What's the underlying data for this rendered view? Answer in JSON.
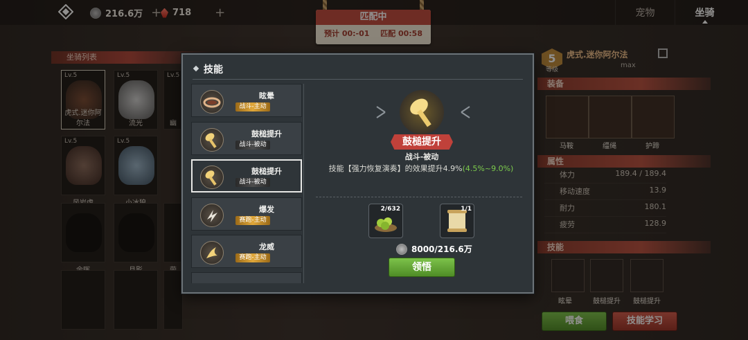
{
  "topbar": {
    "silver": "216.6万",
    "gems": "718",
    "plus": "+"
  },
  "tabs": [
    {
      "label": "宠物"
    },
    {
      "label": "坐骑"
    }
  ],
  "match": {
    "title": "匹配中",
    "estimate": "预计 00:-01",
    "elapsed": "匹配 00:58"
  },
  "mount_list": {
    "header": "坐骑列表",
    "cards": [
      {
        "level": "Lv.5",
        "name": "虎式.迷你阿尔法"
      },
      {
        "level": "Lv.5",
        "name": "流光"
      },
      {
        "level": "Lv.5",
        "name": "幽"
      },
      {
        "level": "Lv.5",
        "name": "风岩虎"
      },
      {
        "level": "Lv.5",
        "name": "小冰狼"
      },
      {
        "level": "",
        "name": "余晖"
      },
      {
        "level": "",
        "name": "月影"
      },
      {
        "level": "",
        "name": "荣"
      }
    ]
  },
  "right_panel": {
    "level_num": "5",
    "level_label": "等级",
    "mount_name": "虎式.迷你阿尔法",
    "max": "max",
    "equipment_header": "装备",
    "equipment": [
      "马鞍",
      "缰绳",
      "护蹄"
    ],
    "attributes_header": "属性",
    "stats": [
      {
        "name": "体力",
        "value": "189.4 / 189.4"
      },
      {
        "name": "移动速度",
        "value": "13.9"
      },
      {
        "name": "耐力",
        "value": "180.1"
      },
      {
        "name": "疲劳",
        "value": "128.9"
      }
    ],
    "skills_header": "技能",
    "skills": [
      "眩晕",
      "鼓槌提升",
      "鼓槌提升"
    ],
    "feed_button": "喂食",
    "learn_skill_button": "技能学习"
  },
  "modal": {
    "title": "技能",
    "skills": [
      {
        "name": "眩晕",
        "tag": "战斗-主动",
        "tag_style": "yellow"
      },
      {
        "name": "鼓槌提升",
        "tag": "战斗-被动",
        "tag_style": "black"
      },
      {
        "name": "鼓槌提升",
        "tag": "战斗-被动",
        "tag_style": "black",
        "selected": true
      },
      {
        "name": "爆发",
        "tag": "赛跑-主动",
        "tag_style": "yellow"
      },
      {
        "name": "龙威",
        "tag": "赛跑-主动",
        "tag_style": "yellow"
      }
    ],
    "detail": {
      "name": "鼓槌提升",
      "type": "战斗-被动",
      "desc_main": "技能【强力恢复演奏】的效果提升4.9%",
      "desc_range": "(4.5%~9.0%)"
    },
    "materials": [
      {
        "count": "2/632",
        "icon": "green-fruit-bowl-icon"
      },
      {
        "count": "1/1",
        "icon": "scroll-icon"
      }
    ],
    "cost": "8000/216.6万",
    "learn_button": "领悟"
  },
  "colors": {
    "accent_red": "#c0413a",
    "accent_green": "#7cc24a",
    "tag_yellow": "#e0a73a",
    "panel": "#2e3438"
  }
}
